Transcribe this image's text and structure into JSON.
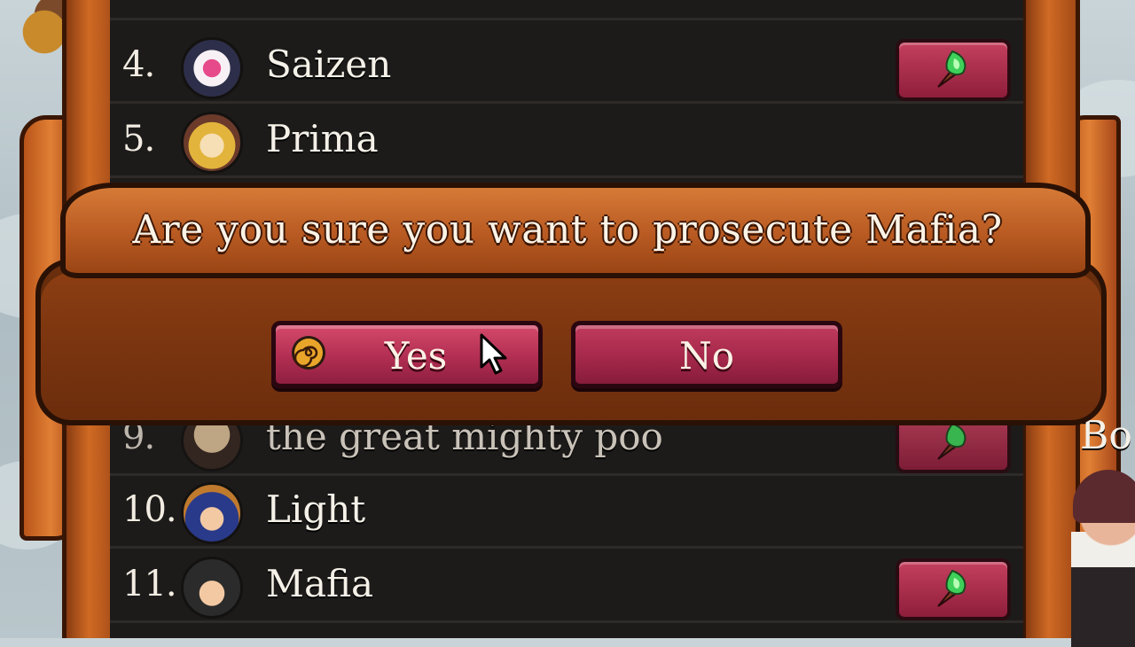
{
  "rows": [
    {
      "num": "4.",
      "name": "Saizen",
      "vote": true,
      "dim": false
    },
    {
      "num": "5.",
      "name": "Prima",
      "vote": false,
      "dim": false
    },
    {
      "num": "9.",
      "name": "the great mighty poo",
      "vote": true,
      "dim": true
    },
    {
      "num": "10.",
      "name": "Light",
      "vote": false,
      "dim": false
    },
    {
      "num": "11.",
      "name": "Mafia",
      "vote": true,
      "dim": false
    }
  ],
  "dialog": {
    "question": "Are you sure you want to prosecute Mafia?",
    "yes_label": "Yes",
    "no_label": "No"
  },
  "side_label": "Bo",
  "icons": {
    "vote": "torch-icon",
    "yes": "spiral-icon",
    "pointer": "mouse-cursor-icon"
  },
  "colors": {
    "button": "#b12e52",
    "panel": "#1d1b1a",
    "wood": "#b85a22"
  }
}
